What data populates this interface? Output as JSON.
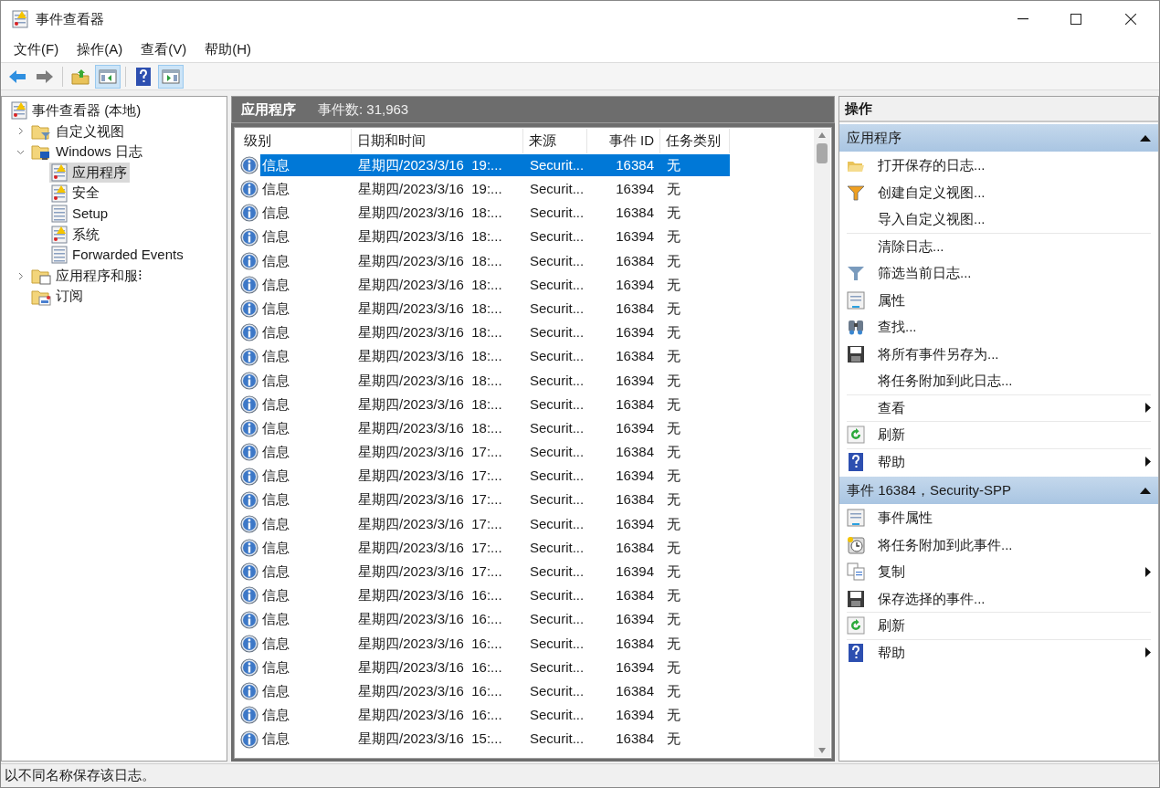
{
  "window": {
    "title": "事件查看器"
  },
  "menu": [
    "文件(F)",
    "操作(A)",
    "查看(V)",
    "帮助(H)"
  ],
  "toolbar": [
    {
      "kind": "back",
      "pressed": false
    },
    {
      "kind": "forward",
      "pressed": false
    },
    {
      "kind": "up",
      "pressed": false
    },
    {
      "kind": "tree",
      "pressed": true
    },
    {
      "kind": "help",
      "pressed": false
    },
    {
      "kind": "actions",
      "pressed": true
    }
  ],
  "tree": [
    {
      "label": "事件查看器 (本地)",
      "kind": "log",
      "selected": false,
      "children": [
        {
          "label": "自定义视图",
          "kind": "folder-filter",
          "expanded": false,
          "selected": false
        },
        {
          "label": "Windows 日志",
          "kind": "folder-pc",
          "expanded": true,
          "selected": false,
          "children": [
            {
              "label": "应用程序",
              "kind": "log",
              "selected": true
            },
            {
              "label": "安全",
              "kind": "log",
              "selected": false
            },
            {
              "label": "Setup",
              "kind": "page",
              "selected": false
            },
            {
              "label": "系统",
              "kind": "log",
              "selected": false
            },
            {
              "label": "Forwarded Events",
              "kind": "page",
              "selected": false
            }
          ]
        },
        {
          "label": "应用程序和服⁝",
          "kind": "folder-window",
          "expanded": false,
          "selected": false
        },
        {
          "label": "订阅",
          "kind": "folder-sub",
          "selected": false
        }
      ]
    }
  ],
  "log_header": {
    "title": "应用程序",
    "count": "事件数: 31,963"
  },
  "table": {
    "columns": [
      "级别",
      "日期和时间",
      "来源",
      "事件 ID",
      "任务类别"
    ],
    "rows": [
      {
        "level": "信息",
        "date": "星期四/2023/3/16  19:...",
        "source": "Securit...",
        "id": "16384",
        "task": "无",
        "selected": true
      },
      {
        "level": "信息",
        "date": "星期四/2023/3/16  19:...",
        "source": "Securit...",
        "id": "16394",
        "task": "无",
        "selected": false
      },
      {
        "level": "信息",
        "date": "星期四/2023/3/16  18:...",
        "source": "Securit...",
        "id": "16384",
        "task": "无",
        "selected": false
      },
      {
        "level": "信息",
        "date": "星期四/2023/3/16  18:...",
        "source": "Securit...",
        "id": "16394",
        "task": "无",
        "selected": false
      },
      {
        "level": "信息",
        "date": "星期四/2023/3/16  18:...",
        "source": "Securit...",
        "id": "16384",
        "task": "无",
        "selected": false
      },
      {
        "level": "信息",
        "date": "星期四/2023/3/16  18:...",
        "source": "Securit...",
        "id": "16394",
        "task": "无",
        "selected": false
      },
      {
        "level": "信息",
        "date": "星期四/2023/3/16  18:...",
        "source": "Securit...",
        "id": "16384",
        "task": "无",
        "selected": false
      },
      {
        "level": "信息",
        "date": "星期四/2023/3/16  18:...",
        "source": "Securit...",
        "id": "16394",
        "task": "无",
        "selected": false
      },
      {
        "level": "信息",
        "date": "星期四/2023/3/16  18:...",
        "source": "Securit...",
        "id": "16384",
        "task": "无",
        "selected": false
      },
      {
        "level": "信息",
        "date": "星期四/2023/3/16  18:...",
        "source": "Securit...",
        "id": "16394",
        "task": "无",
        "selected": false
      },
      {
        "level": "信息",
        "date": "星期四/2023/3/16  18:...",
        "source": "Securit...",
        "id": "16384",
        "task": "无",
        "selected": false
      },
      {
        "level": "信息",
        "date": "星期四/2023/3/16  18:...",
        "source": "Securit...",
        "id": "16394",
        "task": "无",
        "selected": false
      },
      {
        "level": "信息",
        "date": "星期四/2023/3/16  17:...",
        "source": "Securit...",
        "id": "16384",
        "task": "无",
        "selected": false
      },
      {
        "level": "信息",
        "date": "星期四/2023/3/16  17:...",
        "source": "Securit...",
        "id": "16394",
        "task": "无",
        "selected": false
      },
      {
        "level": "信息",
        "date": "星期四/2023/3/16  17:...",
        "source": "Securit...",
        "id": "16384",
        "task": "无",
        "selected": false
      },
      {
        "level": "信息",
        "date": "星期四/2023/3/16  17:...",
        "source": "Securit...",
        "id": "16394",
        "task": "无",
        "selected": false
      },
      {
        "level": "信息",
        "date": "星期四/2023/3/16  17:...",
        "source": "Securit...",
        "id": "16384",
        "task": "无",
        "selected": false
      },
      {
        "level": "信息",
        "date": "星期四/2023/3/16  17:...",
        "source": "Securit...",
        "id": "16394",
        "task": "无",
        "selected": false
      },
      {
        "level": "信息",
        "date": "星期四/2023/3/16  16:...",
        "source": "Securit...",
        "id": "16384",
        "task": "无",
        "selected": false
      },
      {
        "level": "信息",
        "date": "星期四/2023/3/16  16:...",
        "source": "Securit...",
        "id": "16394",
        "task": "无",
        "selected": false
      },
      {
        "level": "信息",
        "date": "星期四/2023/3/16  16:...",
        "source": "Securit...",
        "id": "16384",
        "task": "无",
        "selected": false
      },
      {
        "level": "信息",
        "date": "星期四/2023/3/16  16:...",
        "source": "Securit...",
        "id": "16394",
        "task": "无",
        "selected": false
      },
      {
        "level": "信息",
        "date": "星期四/2023/3/16  16:...",
        "source": "Securit...",
        "id": "16384",
        "task": "无",
        "selected": false
      },
      {
        "level": "信息",
        "date": "星期四/2023/3/16  16:...",
        "source": "Securit...",
        "id": "16394",
        "task": "无",
        "selected": false
      },
      {
        "level": "信息",
        "date": "星期四/2023/3/16  15:...",
        "source": "Securit...",
        "id": "16384",
        "task": "无",
        "selected": false
      }
    ]
  },
  "actions": {
    "title": "操作",
    "sections": [
      {
        "title": "应用程序",
        "expanded": true,
        "items": [
          {
            "label": "打开保存的日志...",
            "kind": "folder",
            "submenu": false,
            "divider": false
          },
          {
            "label": "创建自定义视图...",
            "kind": "filter-color",
            "submenu": false,
            "divider": false
          },
          {
            "label": "导入自定义视图...",
            "kind": "none",
            "submenu": false,
            "divider": false
          },
          {
            "label": "清除日志...",
            "kind": "none",
            "submenu": false,
            "divider": true
          },
          {
            "label": "筛选当前日志...",
            "kind": "filter",
            "submenu": false,
            "divider": false
          },
          {
            "label": "属性",
            "kind": "properties",
            "submenu": false,
            "divider": false
          },
          {
            "label": "查找...",
            "kind": "find",
            "submenu": false,
            "divider": false
          },
          {
            "label": "将所有事件另存为...",
            "kind": "save",
            "submenu": false,
            "divider": false
          },
          {
            "label": "将任务附加到此日志...",
            "kind": "none",
            "submenu": false,
            "divider": false
          },
          {
            "label": "查看",
            "kind": "none",
            "submenu": true,
            "divider": true
          },
          {
            "label": "刷新",
            "kind": "refresh",
            "submenu": false,
            "divider": true
          },
          {
            "label": "帮助",
            "kind": "help",
            "submenu": true,
            "divider": true
          }
        ]
      },
      {
        "title": "事件 16384，Security-SPP",
        "expanded": true,
        "items": [
          {
            "label": "事件属性",
            "kind": "properties",
            "submenu": false,
            "divider": false
          },
          {
            "label": "将任务附加到此事件...",
            "kind": "clock",
            "submenu": false,
            "divider": false
          },
          {
            "label": "复制",
            "kind": "copy",
            "submenu": true,
            "divider": false
          },
          {
            "label": "保存选择的事件...",
            "kind": "save",
            "submenu": false,
            "divider": false
          },
          {
            "label": "刷新",
            "kind": "refresh",
            "submenu": false,
            "divider": true
          },
          {
            "label": "帮助",
            "kind": "help",
            "submenu": true,
            "divider": true
          }
        ]
      }
    ]
  },
  "status_bar": "以不同名称保存该日志。"
}
